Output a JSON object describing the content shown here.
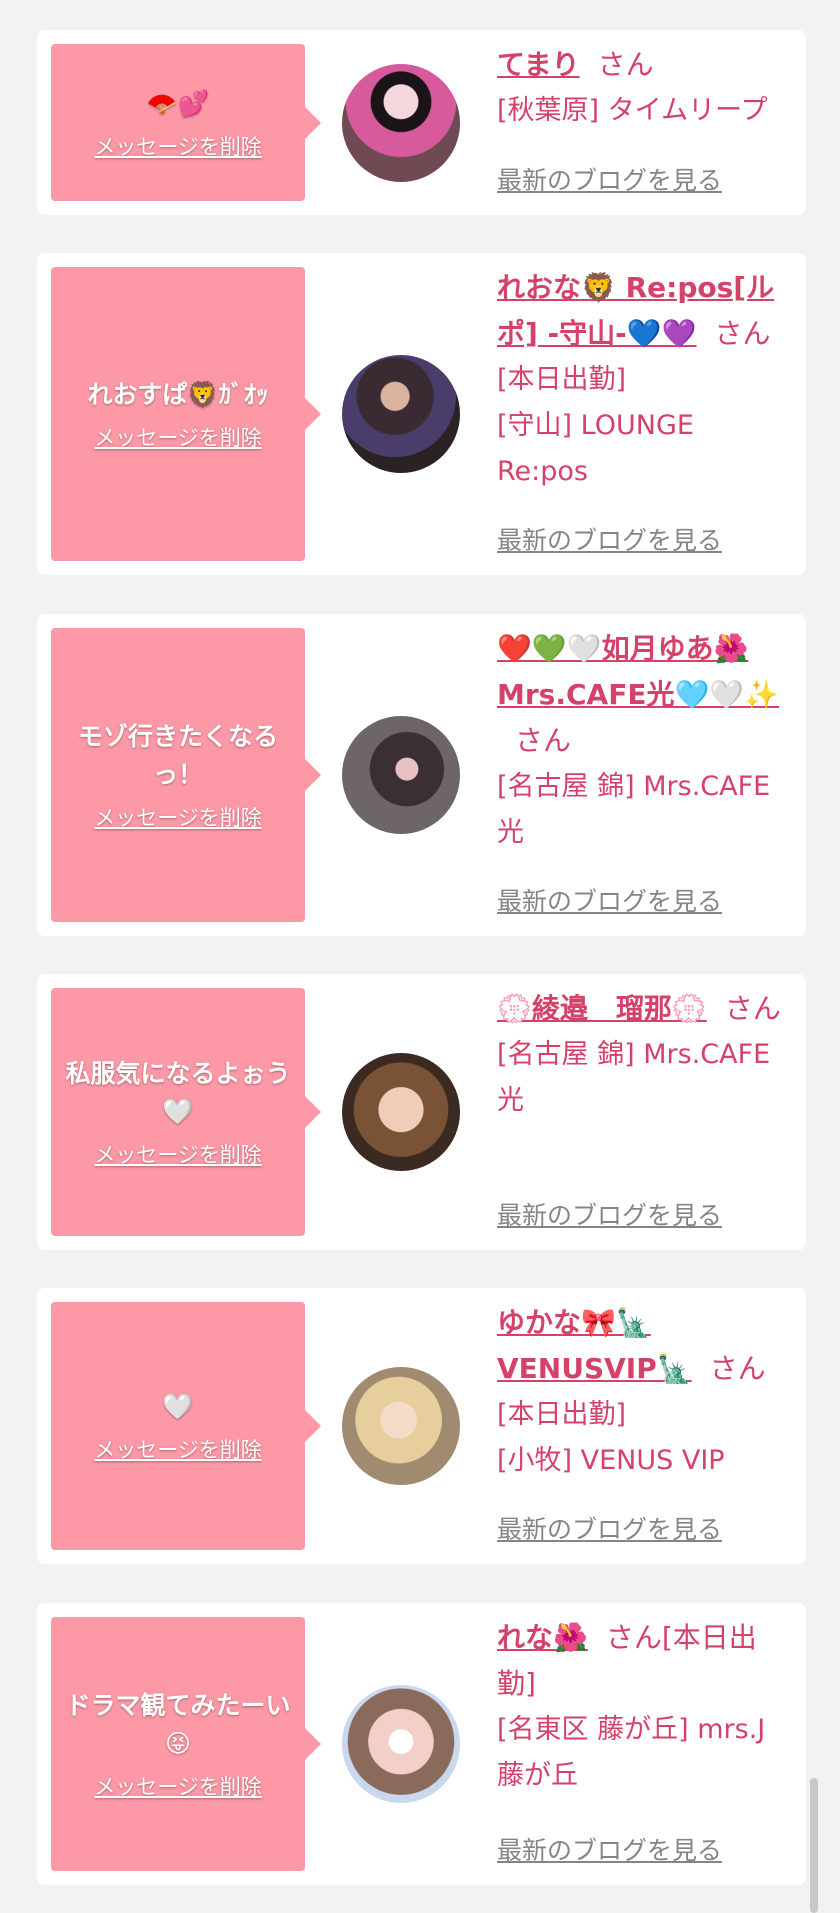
{
  "colors": {
    "page_bg": "#f2f2f2",
    "card_bg": "#ffffff",
    "bubble": "#fd98a6",
    "accent_text": "#d4426a",
    "link_gray": "#858585"
  },
  "entries": [
    {
      "message": "🪭💕",
      "delete_label": "メッセージを削除",
      "name": "てまり",
      "san": "さん",
      "details": [
        "[秋葉原] タイムリープ"
      ],
      "blog_link": "最新のブログを見る",
      "avatar_icon": "avatar-girl-kimono-photo"
    },
    {
      "message": "れおすぱ🦁ｶﾞｵｯ",
      "delete_label": "メッセージを削除",
      "name": "れおな🦁 Re:pos[ルポ] -守山-💙💜",
      "san": "さん",
      "details": [
        "[本日出勤]",
        "[守山] LOUNGE Re:pos"
      ],
      "blog_link": "最新のブログを見る",
      "avatar_icon": "avatar-woman-dress-photo"
    },
    {
      "message": "モゾ行きたくなるっ！",
      "delete_label": "メッセージを削除",
      "name": "❤️💚🤍如月ゆあ🌺Mrs.CAFE光🩵🤍✨",
      "san": "さん",
      "details": [
        "[名古屋 錦] Mrs.CAFE光"
      ],
      "blog_link": "最新のブログを見る",
      "avatar_icon": "avatar-woman-hair-photo"
    },
    {
      "message": "私服気になるよぉう🤍",
      "delete_label": "メッセージを削除",
      "name": "💮綾邉　瑠那💮",
      "san": "さん",
      "details": [
        "[名古屋 錦] Mrs.CAFE光"
      ],
      "blog_link": "最新のブログを見る",
      "avatar_icon": "avatar-woman-portrait-photo"
    },
    {
      "message": "🤍",
      "delete_label": "メッセージを削除",
      "name": "ゆかな🎀🗽VENUSVIP🗽",
      "san": "さん",
      "details": [
        "[本日出勤]",
        "[小牧] VENUS VIP"
      ],
      "blog_link": "最新のブログを見る",
      "avatar_icon": "avatar-blonde-woman-photo"
    },
    {
      "message": "ドラマ観てみたーい😝",
      "delete_label": "メッセージを削除",
      "name": "れな🌺",
      "san": "さん[本日出勤]",
      "details": [
        "[名東区 藤が丘] mrs.J藤が丘"
      ],
      "blog_link": "最新のブログを見る",
      "avatar_icon": "avatar-woman-heart-sticker-photo"
    }
  ]
}
